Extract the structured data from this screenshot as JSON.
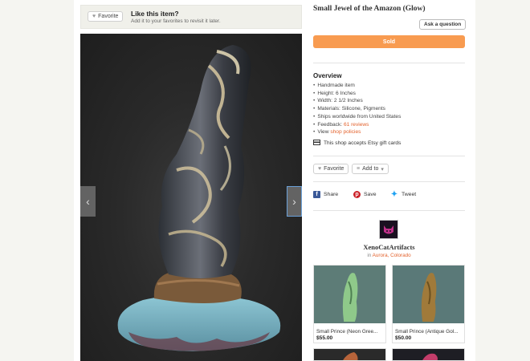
{
  "favorite_bar": {
    "button_label": "Favorite",
    "title": "Like this item?",
    "subtitle": "Add it to your favorites to revisit it later."
  },
  "product": {
    "title": "Small Jewel of the Amazon (Glow)",
    "ask_label": "Ask a question",
    "status_label": "Sold",
    "overview_title": "Overview",
    "overview": {
      "handmade": "Handmade item",
      "height": "Height: 6 Inches",
      "width": "Width: 2 1/2 Inches",
      "materials": "Materials: Silicone, Pigments",
      "ships": "Ships worldwide from United States",
      "feedback_prefix": "Feedback: ",
      "feedback_link": "61 reviews",
      "view_prefix": "View ",
      "view_link": "shop policies"
    },
    "gift_cards": "This shop accepts Etsy gift cards",
    "favorite_label": "Favorite",
    "add_to_label": "Add to"
  },
  "share": {
    "facebook": "Share",
    "pinterest": "Save",
    "twitter": "Tweet"
  },
  "shop": {
    "name": "XenoCatArtifacts",
    "location_prefix": "in ",
    "location": "Aurora, Colorado"
  },
  "listings": [
    {
      "name": "Small Prince (Neon Gree...",
      "price": "$55.00"
    },
    {
      "name": "Small Prince (Antique Gol...",
      "price": "$50.00"
    }
  ],
  "colors": {
    "accent": "#f89b50",
    "link": "#e3622d",
    "facebook": "#3b5998",
    "pinterest": "#cb2027",
    "twitter": "#1da1f2"
  },
  "icons": {
    "heart": "heart-icon",
    "gift": "gift-card-icon",
    "chevron_left": "chevron-left-icon",
    "chevron_right": "chevron-right-icon"
  }
}
